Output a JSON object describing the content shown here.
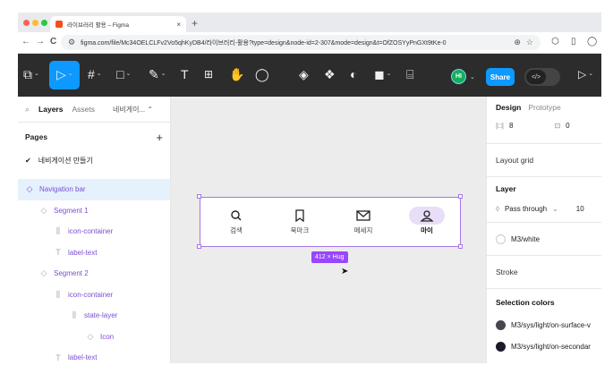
{
  "browser": {
    "tab_title": "라이브러리 활용 – Figma",
    "tab_close": "×",
    "new_tab": "+",
    "url": "figma.com/file/Mc34OELCLFv2Vo5qhKyDB4/라이브러리-활용?type=design&node-id=2-307&mode=design&t=OfZOSYyPnGXt9tKe-0",
    "back": "←",
    "forward": "→",
    "reload": "C"
  },
  "toolbar": {
    "avatar_initials": "HI",
    "share_label": "Share",
    "dev_mode_glyph": "</>",
    "play_glyph": "▷"
  },
  "left_panel": {
    "tab_layers": "Layers",
    "tab_assets": "Assets",
    "page_dropdown": "네비게이...",
    "pages_title": "Pages",
    "pages_add": "+",
    "current_page": "네비게이션 만들기",
    "layers": [
      {
        "label": "Navigation bar",
        "icon": "◇"
      },
      {
        "label": "Segment 1",
        "icon": "◇"
      },
      {
        "label": "icon-container",
        "icon": "⫼"
      },
      {
        "label": "label-text",
        "icon": "T"
      },
      {
        "label": "Segment 2",
        "icon": "◇"
      },
      {
        "label": "icon-container",
        "icon": "⫼"
      },
      {
        "label": "state-layer",
        "icon": "⫼"
      },
      {
        "label": "Icon",
        "icon": "◇"
      },
      {
        "label": "label-text",
        "icon": "T"
      }
    ]
  },
  "canvas": {
    "nav_items": [
      {
        "label": "검색",
        "icon": "search-icon"
      },
      {
        "label": "북마크",
        "icon": "bookmark-icon"
      },
      {
        "label": "메세지",
        "icon": "mail-icon"
      },
      {
        "label": "마이",
        "icon": "person-icon"
      }
    ],
    "size_badge": "412 × Hug"
  },
  "right_panel": {
    "tab_design": "Design",
    "tab_prototype": "Prototype",
    "padding_value": "8",
    "gap_value": "0",
    "layout_grid": "Layout grid",
    "layer_title": "Layer",
    "blend_mode": "Pass through",
    "opacity": "10",
    "fill_style": "M3/white",
    "stroke_title": "Stroke",
    "selection_colors_title": "Selection colors",
    "selection_colors": [
      {
        "name": "M3/sys/light/on-surface-v",
        "color": "#49454f"
      },
      {
        "name": "M3/sys/light/on-secondar",
        "color": "#1d192b"
      }
    ]
  },
  "colors": {
    "figma_toolbar": "#2c2c2c",
    "accent_blue": "#0d99ff",
    "component_purple": "#9747ff",
    "active_pill": "#e8def8"
  }
}
